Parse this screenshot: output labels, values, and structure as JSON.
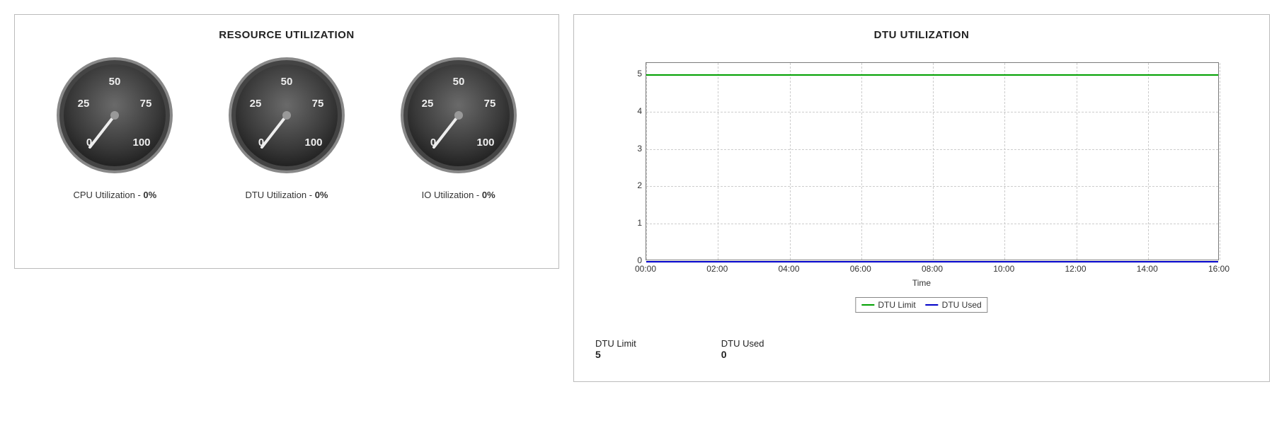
{
  "left_panel": {
    "title": "RESOURCE UTILIZATION",
    "gauges": [
      {
        "label": "CPU Utilization - ",
        "value_text": "0%",
        "value": 0,
        "ticks": [
          "0",
          "25",
          "50",
          "75",
          "100"
        ]
      },
      {
        "label": "DTU Utilization - ",
        "value_text": "0%",
        "value": 0,
        "ticks": [
          "0",
          "25",
          "50",
          "75",
          "100"
        ]
      },
      {
        "label": "IO Utilization - ",
        "value_text": "0%",
        "value": 0,
        "ticks": [
          "0",
          "25",
          "50",
          "75",
          "100"
        ]
      }
    ]
  },
  "right_panel": {
    "title": "DTU UTILIZATION",
    "xlabel": "Time",
    "summary": [
      {
        "label": "DTU Limit",
        "value": "5"
      },
      {
        "label": "DTU Used",
        "value": "0"
      }
    ]
  },
  "chart_data": {
    "type": "line",
    "title": "DTU UTILIZATION",
    "xlabel": "Time",
    "ylabel": "",
    "ylim": [
      0,
      5.3
    ],
    "y_ticks": [
      0,
      1,
      2,
      3,
      4,
      5
    ],
    "x_ticks": [
      "00:00",
      "02:00",
      "04:00",
      "06:00",
      "08:00",
      "10:00",
      "12:00",
      "14:00",
      "16:00"
    ],
    "legend_position": "bottom",
    "series": [
      {
        "name": "DTU Limit",
        "color": "#00a000",
        "x": [
          "00:00",
          "02:00",
          "04:00",
          "06:00",
          "08:00",
          "10:00",
          "12:00",
          "14:00",
          "16:00"
        ],
        "values": [
          5,
          5,
          5,
          5,
          5,
          5,
          5,
          5,
          5
        ]
      },
      {
        "name": "DTU Used",
        "color": "#0000c8",
        "x": [
          "00:00",
          "02:00",
          "04:00",
          "06:00",
          "08:00",
          "10:00",
          "12:00",
          "14:00",
          "16:00"
        ],
        "values": [
          0,
          0,
          0,
          0,
          0,
          0,
          0,
          0,
          0
        ]
      }
    ]
  }
}
